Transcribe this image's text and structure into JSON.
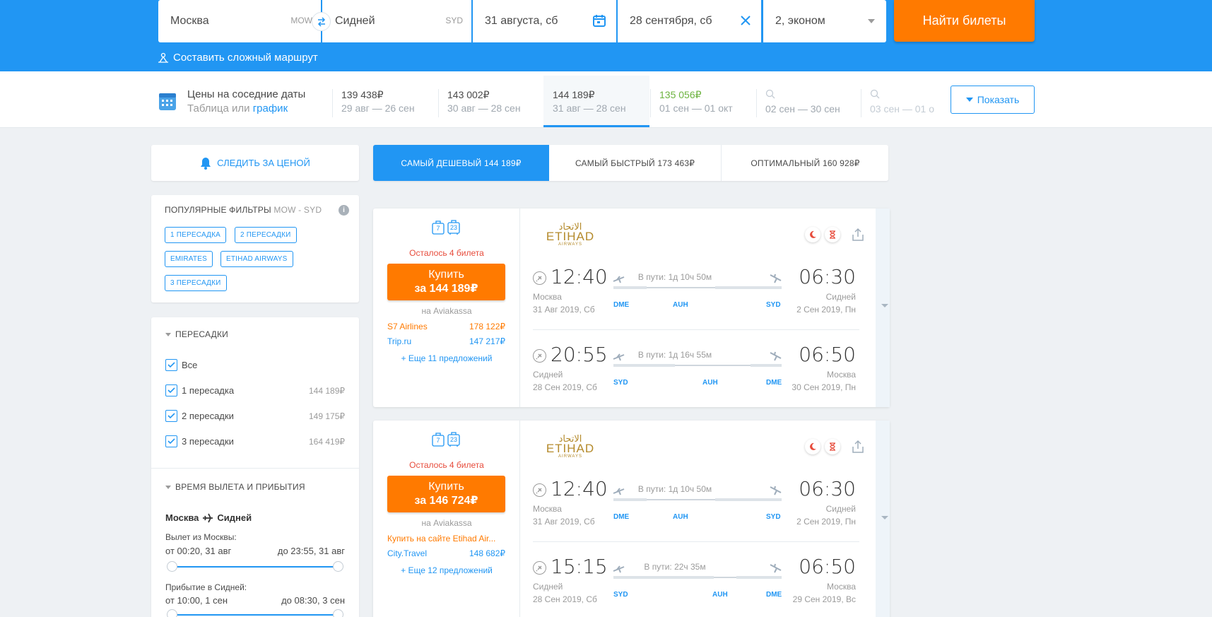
{
  "search": {
    "from_city": "Москва",
    "from_code": "MOW",
    "to_city": "Сидней",
    "to_code": "SYD",
    "depart_date": "31 августа, сб",
    "return_date": "28 сентября, сб",
    "passengers": "2, эконом",
    "search_button": "Найти билеты",
    "complex_route": "Составить сложный маршрут"
  },
  "nearby_dates": {
    "title": "Цены на соседние даты",
    "table_label": "Таблица",
    "or_label": "или",
    "chart_label": "график",
    "cells": [
      {
        "price": "139 438₽",
        "dates": "29 авг — 26 сен"
      },
      {
        "price": "143 002₽",
        "dates": "30 авг — 28 сен"
      },
      {
        "price": "144 189₽",
        "dates": "31 авг — 28 сен"
      },
      {
        "price": "135 056₽",
        "dates": "01 сен — 01 окт"
      },
      {
        "price": "",
        "dates": "02 сен — 30 сен"
      },
      {
        "price": "",
        "dates": "03 сен — 01 о"
      }
    ],
    "show_button": "Показать"
  },
  "sidebar": {
    "track_price": "СЛЕДИТЬ ЗА ЦЕНОЙ",
    "popular_title": "ПОПУЛЯРНЫЕ ФИЛЬТРЫ",
    "popular_route": "MOW - SYD",
    "tags": [
      "1 ПЕРЕСАДКА",
      "2 ПЕРЕСАДКИ",
      "EMIRATES",
      "ETIHAD AIRWAYS",
      "3 ПЕРЕСАДКИ"
    ],
    "stops_title": "ПЕРЕСАДКИ",
    "stops": [
      {
        "label": "Все",
        "price": ""
      },
      {
        "label": "1 пересадка",
        "price": "144 189₽"
      },
      {
        "label": "2 пересадки",
        "price": "149 175₽"
      },
      {
        "label": "3 пересадки",
        "price": "164 419₽"
      }
    ],
    "time_title": "ВРЕМЯ ВЫЛЕТА И ПРИБЫТИЯ",
    "route_from": "Москва",
    "route_to": "Сидней",
    "dep_label": "Вылет из Москвы:",
    "dep_from": "от 00:20, 31 авг",
    "dep_to": "до 23:55, 31 авг",
    "arr_label": "Прибытие в Сидней:",
    "arr_from": "от 10:00, 1 сен",
    "arr_to": "до 08:30, 3 сен"
  },
  "sort_tabs": [
    {
      "label": "САМЫЙ ДЕШЕВЫЙ",
      "price": "144 189₽"
    },
    {
      "label": "САМЫЙ БЫСТРЫЙ",
      "price": "173 463₽"
    },
    {
      "label": "ОПТИМАЛЬНЫЙ",
      "price": "160 928₽"
    }
  ],
  "tickets": [
    {
      "baggage_a": "7",
      "baggage_b": "23",
      "seats_left": "Осталось 4 билета",
      "buy_line1": "Купить",
      "buy_line2": "за 144 189₽",
      "via": "на Aviakassa",
      "offers": [
        {
          "name": "S7 Airlines",
          "price": "178 122₽",
          "color": "#ff7a00"
        },
        {
          "name": "Trip.ru",
          "price": "147 217₽",
          "color": "#2196f3"
        }
      ],
      "more": "+ Еще 11 предложений",
      "logo_script": "الاتحاد",
      "logo": "ETIHAD",
      "logo_sub": "AIRWAYS",
      "segments": [
        {
          "dep_time": "12:40",
          "arr_time": "06:30",
          "duration": "В пути: 1д 10ч 50м",
          "dep_city": "Москва",
          "dep_date": "31 Авг 2019, Сб",
          "arr_city": "Сидней",
          "arr_date": "2 Сен 2019, Пн",
          "ap1": "DME",
          "ap2": "AUH",
          "ap3": "SYD"
        },
        {
          "dep_time": "20:55",
          "arr_time": "06:50",
          "duration": "В пути: 1д 16ч 55м",
          "dep_city": "Сидней",
          "dep_date": "28 Сен 2019, Сб",
          "arr_city": "Москва",
          "arr_date": "30 Сен 2019, Пн",
          "ap1": "SYD",
          "ap2": "AUH",
          "ap3": "DME"
        }
      ]
    },
    {
      "baggage_a": "7",
      "baggage_b": "23",
      "seats_left": "Осталось 4 билета",
      "buy_line1": "Купить",
      "buy_line2": "за 146 724₽",
      "via": "на Aviakassa",
      "offers": [
        {
          "name": "Купить на сайте Etihad Air...",
          "price": "",
          "color": "#ff7a00"
        },
        {
          "name": "City.Travel",
          "price": "148 682₽",
          "color": "#2196f3"
        }
      ],
      "more": "+ Еще 12 предложений",
      "logo_script": "الاتحاد",
      "logo": "ETIHAD",
      "logo_sub": "AIRWAYS",
      "segments": [
        {
          "dep_time": "12:40",
          "arr_time": "06:30",
          "duration": "В пути: 1д 10ч 50м",
          "dep_city": "Москва",
          "dep_date": "31 Авг 2019, Сб",
          "arr_city": "Сидней",
          "arr_date": "2 Сен 2019, Пн",
          "ap1": "DME",
          "ap2": "AUH",
          "ap3": "SYD"
        },
        {
          "dep_time": "15:15",
          "arr_time": "06:50",
          "duration": "В пути: 22ч 35м",
          "dep_city": "Сидней",
          "dep_date": "28 Сен 2019, Сб",
          "arr_city": "Москва",
          "arr_date": "29 Сен 2019, Вс",
          "ap1": "SYD",
          "ap2": "AUH",
          "ap3": "DME"
        }
      ]
    }
  ],
  "colors": {
    "brand": "#2196f3",
    "accent": "#ff7a00",
    "green": "#6cb33f",
    "alert": "#e74c3c"
  }
}
